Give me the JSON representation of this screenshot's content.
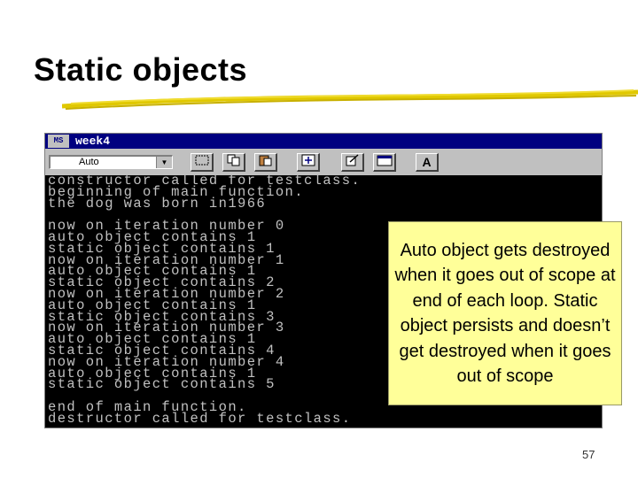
{
  "slide": {
    "title": "Static objects",
    "page_number": "57"
  },
  "window": {
    "title": "week4",
    "icon_label": "MS DOS",
    "font_select_value": "Auto",
    "toolbar_icons": [
      "select-icon",
      "copy-icon",
      "paste-icon",
      "fullscreen-icon",
      "properties-icon",
      "background-icon",
      "font-icon"
    ],
    "font_button_label": "A"
  },
  "console": {
    "lines": [
      "constructor called for testclass.",
      "beginning of main function.",
      "the dog was born in1966",
      "",
      "now on iteration number 0",
      "auto object contains 1",
      "static object contains 1",
      "now on iteration number 1",
      "auto object contains 1",
      "static object contains 2",
      "now on iteration number 2",
      "auto object contains 1",
      "static object contains 3",
      "now on iteration number 3",
      "auto object contains 1",
      "static object contains 4",
      "now on iteration number 4",
      "auto object contains 1",
      "static object contains 5",
      "",
      "end of main function.",
      "destructor called for testclass."
    ]
  },
  "callout": {
    "text": "Auto object gets destroyed when it goes out of scope at end of each loop. Static object persists and doesn’t get destroyed when it goes out of scope"
  },
  "colors": {
    "title_bar": "#000080",
    "console_bg": "#000000",
    "console_text": "#c0c0c0",
    "callout_bg": "#ffff99",
    "underline": "#e0c800"
  }
}
